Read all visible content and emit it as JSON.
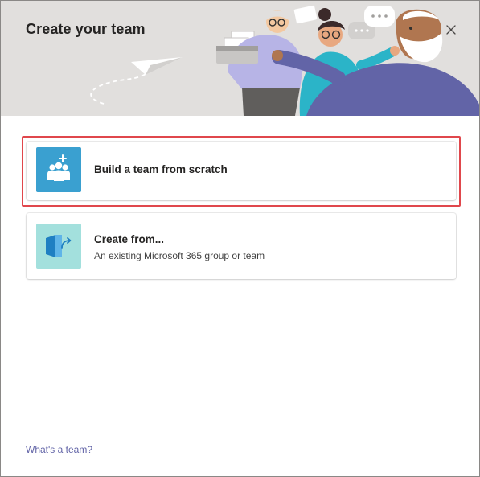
{
  "dialog": {
    "title": "Create your team",
    "close_icon": "close-icon"
  },
  "options": [
    {
      "title": "Build a team from scratch",
      "icon": "team-add-icon",
      "icon_bg": "#3aa0d0"
    },
    {
      "title": "Create from...",
      "description": "An existing Microsoft 365 group or team",
      "icon": "create-from-existing-icon",
      "icon_bg": "#a3e0dd"
    }
  ],
  "footer": {
    "help_link": "What's a team?"
  },
  "colors": {
    "header_bg": "#e1dfdd",
    "link": "#6264a7",
    "highlight": "#e0474c"
  }
}
